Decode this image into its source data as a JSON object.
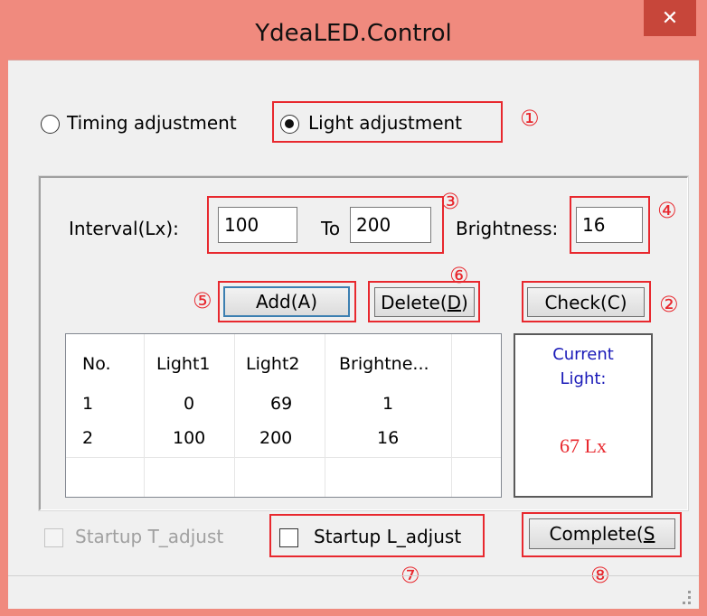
{
  "window": {
    "title": "YdeaLED.Control",
    "close_glyph": "✕",
    "accent_color": "#f08a7e"
  },
  "mode": {
    "timing_label": "Timing adjustment",
    "light_label": "Light adjustment",
    "selected": "light"
  },
  "interval": {
    "label": "Interval(Lx):",
    "from_value": "100",
    "to_label": "To",
    "to_value": "200"
  },
  "brightness": {
    "label": "Brightness:",
    "value": "16"
  },
  "buttons": {
    "add": "Add(A)",
    "delete_prefix": "Delete(",
    "delete_key": "D",
    "delete_suffix": ")",
    "check": "Check(C)",
    "complete_prefix": "Complete(",
    "complete_key": "S"
  },
  "table": {
    "headers": [
      "No.",
      "Light1",
      "Light2",
      "Brightne..."
    ],
    "rows": [
      [
        "1",
        "0",
        "69",
        "1"
      ],
      [
        "2",
        "100",
        "200",
        "16"
      ]
    ]
  },
  "current_light": {
    "label_line1": "Current",
    "label_line2": "Light:",
    "value": "67 Lx",
    "label_color": "#1a1ab8",
    "value_color": "#e8282e"
  },
  "startup": {
    "t_adjust_label": "Startup T_adjust",
    "l_adjust_label": "Startup L_adjust"
  },
  "annotations": {
    "n1": "①",
    "n2": "②",
    "n3": "③",
    "n4": "④",
    "n5": "⑤",
    "n6": "⑥",
    "n7": "⑦",
    "n8": "⑧",
    "color": "#e8282e"
  }
}
